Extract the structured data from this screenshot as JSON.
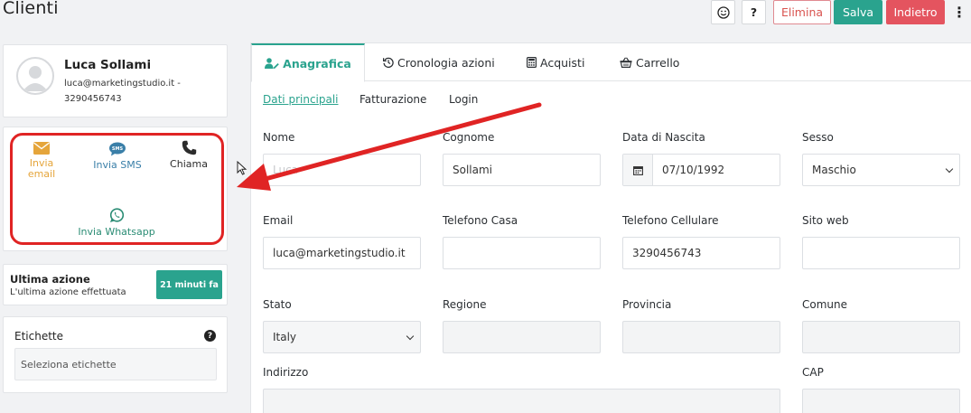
{
  "header": {
    "title": "Clienti",
    "emoji_icon": "smile-icon",
    "help_label": "?",
    "delete_label": "Elimina",
    "save_label": "Salva",
    "back_label": "Indietro",
    "more_label": "⋮"
  },
  "profile": {
    "name": "Luca Sollami",
    "email_phone": "luca@marketingstudio.it - 3290456743"
  },
  "actions": {
    "email_label": "Invia email",
    "sms_label": "Invia SMS",
    "call_label": "Chiama",
    "whatsapp_label": "Invia Whatsapp"
  },
  "last_action": {
    "title": "Ultima azione",
    "subtitle": "L'ultima azione effettuata",
    "badge": "21 minuti fa"
  },
  "tags": {
    "label": "Etichette",
    "placeholder": "Seleziona etichette"
  },
  "tabs": [
    {
      "label": "Anagrafica"
    },
    {
      "label": "Cronologia azioni"
    },
    {
      "label": "Acquisti"
    },
    {
      "label": "Carrello"
    }
  ],
  "subtabs": [
    {
      "label": "Dati principali"
    },
    {
      "label": "Fatturazione"
    },
    {
      "label": "Login"
    }
  ],
  "form": {
    "nome": {
      "label": "Nome",
      "value": "Luca"
    },
    "cognome": {
      "label": "Cognome",
      "value": "Sollami"
    },
    "data_nascita": {
      "label": "Data di Nascita",
      "value": "07/10/1992"
    },
    "sesso": {
      "label": "Sesso",
      "value": "Maschio"
    },
    "email": {
      "label": "Email",
      "value": "luca@marketingstudio.it"
    },
    "telefono_casa": {
      "label": "Telefono Casa",
      "value": ""
    },
    "telefono_cellulare": {
      "label": "Telefono Cellulare",
      "value": "3290456743"
    },
    "sito_web": {
      "label": "Sito web",
      "value": ""
    },
    "stato": {
      "label": "Stato",
      "value": "Italy"
    },
    "regione": {
      "label": "Regione",
      "value": ""
    },
    "provincia": {
      "label": "Provincia",
      "value": ""
    },
    "comune": {
      "label": "Comune",
      "value": ""
    },
    "indirizzo": {
      "label": "Indirizzo",
      "value": ""
    },
    "cap": {
      "label": "CAP",
      "value": ""
    }
  },
  "colors": {
    "accent": "#2aa38e",
    "danger": "#e4545f",
    "annotation": "#e02424"
  }
}
